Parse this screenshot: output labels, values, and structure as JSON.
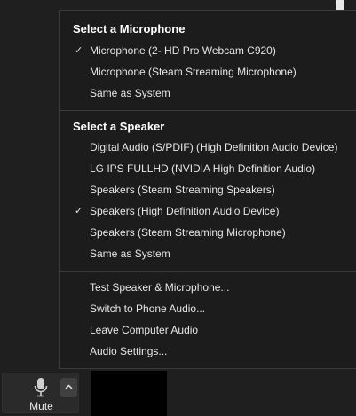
{
  "menu": {
    "microphone": {
      "header": "Select a Microphone",
      "items": [
        {
          "label": "Microphone (2- HD Pro Webcam C920)",
          "checked": true
        },
        {
          "label": "Microphone (Steam Streaming Microphone)",
          "checked": false
        },
        {
          "label": "Same as System",
          "checked": false
        }
      ]
    },
    "speaker": {
      "header": "Select a Speaker",
      "items": [
        {
          "label": "Digital Audio (S/PDIF) (High Definition Audio Device)",
          "checked": false
        },
        {
          "label": "LG IPS FULLHD (NVIDIA High Definition Audio)",
          "checked": false
        },
        {
          "label": "Speakers (Steam Streaming Speakers)",
          "checked": false
        },
        {
          "label": "Speakers (High Definition Audio Device)",
          "checked": true
        },
        {
          "label": "Speakers (Steam Streaming Microphone)",
          "checked": false
        },
        {
          "label": "Same as System",
          "checked": false
        }
      ]
    },
    "actions": [
      {
        "label": "Test Speaker & Microphone..."
      },
      {
        "label": "Switch to Phone Audio..."
      },
      {
        "label": "Leave Computer Audio"
      },
      {
        "label": "Audio Settings..."
      }
    ],
    "check_glyph": "✓"
  },
  "toolbar": {
    "mute_label": "Mute",
    "mic_icon": "microphone-icon",
    "caret_icon": "chevron-up-icon"
  },
  "colors": {
    "background": "#1f1f1f",
    "menu_background": "#1c1c1c",
    "text": "#e6e6e6",
    "header_text": "#ffffff"
  }
}
